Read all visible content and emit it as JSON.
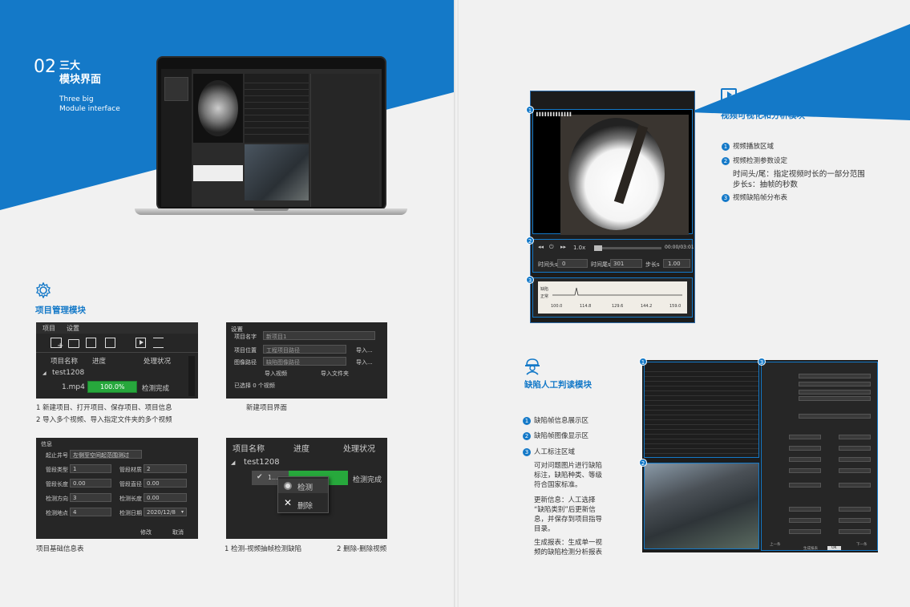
{
  "left_page": {
    "section_number": "02",
    "section_title_line1": "三大",
    "section_title_line2": "模块界面",
    "section_subtitle_line1": "Three big",
    "section_subtitle_line2": "Module interface",
    "project_module": {
      "heading": "项目管理模块",
      "menu_project": "项目",
      "menu_settings": "设置",
      "col_name": "项目名称",
      "col_progress": "进度",
      "col_status": "处理状况",
      "tree_root": "test1208",
      "file_name": "1.mp4",
      "progress_text": "100.0%",
      "status_text": "检测完成",
      "caption_line1": "1 新建项目、打开项目、保存项目、项目信息",
      "caption_line2": "2 导入多个视频、导入指定文件夹的多个视频"
    },
    "new_project": {
      "title": "设置",
      "label_name": "项目名字",
      "value_name": "新项目1",
      "label_path": "项目位置",
      "value_path": "工程项目路径",
      "label_image_path": "图像路径",
      "value_image_path": "缺陷图像路径",
      "import_label": "导入...",
      "btn_import_video": "导入视频",
      "btn_import_folder": "导入文件夹",
      "selected_text": "已选择 0 个视频",
      "caption": "新建项目界面"
    },
    "basic_info": {
      "title": "信息",
      "label_start": "起止井号",
      "value_start": "左侧至空间起范围测过",
      "label_type": "管段类型",
      "value_type": "1",
      "label_material": "管段材质",
      "value_material": "2",
      "label_length": "管段长度",
      "value_length": "0.00",
      "label_diameter": "管段直径",
      "value_diameter": "0.00",
      "label_direction": "检测方向",
      "value_direction": "3",
      "label_detect_length": "检测长度",
      "value_detect_length": "0.00",
      "label_location": "检测地点",
      "value_location": "4",
      "label_date": "检测日期",
      "value_date": "2020/12/8",
      "btn_modify": "修改",
      "btn_cancel": "取消",
      "caption": "项目基础信息表"
    },
    "context_menu": {
      "col_name": "项目名称",
      "col_progress": "进度",
      "col_status": "处理状况",
      "tree_root": "test1208",
      "file_short": "1...",
      "status_text": "检测完成",
      "menu_detect": "检测",
      "menu_delete": "删除",
      "caption_left": "1 检测-视频抽帧检测缺陷",
      "caption_right": "2 删除-删除视频"
    }
  },
  "right_page": {
    "video_module": {
      "heading": "视频可视化和分析模块",
      "item1": "视频播放区域",
      "item2": "视频检测参数设定",
      "item2_detail1": "时间头/尾：指定视频时长的一部分范围",
      "item2_detail2": "步长s：抽帧的秒数",
      "item3": "视频缺陷帧分布表",
      "speed": "1.0x",
      "time_display": "00:00/03:01",
      "label_head": "时间头s",
      "value_head": "0",
      "label_tail": "时间尾s",
      "value_tail": "301",
      "label_step": "步长s",
      "value_step": "1.00",
      "chart_label_defect": "缺陷",
      "chart_label_normal": "正常",
      "chart_ticks": [
        "100.0",
        "114.8",
        "129.6",
        "144.2",
        "159.0"
      ]
    },
    "defect_module": {
      "heading": "缺陷人工判读模块",
      "item1": "缺陷帧信息展示区",
      "item2": "缺陷帧图像显示区",
      "item3": "人工标注区域",
      "item3_text1": "可对问题图片进行缺陷",
      "item3_text2": "标注，缺陷种类、等级",
      "item3_text3": "符合国家标准。",
      "update_text1": "更新信息：人工选择",
      "update_text2": "“缺陷类别”后更新信",
      "update_text3": "息，并保存到项目指导",
      "update_text4": "目录。",
      "report_text1": "生成报表：生成单一视",
      "report_text2": "频的缺陷检测分析报表",
      "btn_prev": "上一条",
      "btn_next": "下一条",
      "btn_generate": "生成报表",
      "btn_ok": "OK"
    }
  },
  "badges": [
    "1",
    "2",
    "3"
  ]
}
